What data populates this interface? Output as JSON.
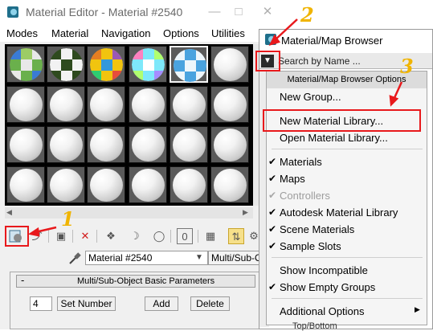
{
  "material_editor": {
    "title": "Material Editor - Material #2540",
    "menu": [
      "Modes",
      "Material",
      "Navigation",
      "Options",
      "Utilities"
    ],
    "material_name": "Material #2540",
    "material_type": "Multi/Sub-Obj",
    "rollout_title": "Multi/Sub-Object Basic Parameters",
    "rollout_collapse": "-",
    "sub_count": "4",
    "set_number_label": "Set Number",
    "add_label": "Add",
    "delete_label": "Delete"
  },
  "browser": {
    "title": "Material/Map Browser",
    "search_placeholder": "Search by Name ...",
    "menu_button_icon": "triangle-down-icon",
    "options_header": "Material/Map Browser Options",
    "items": {
      "new_group": "New Group...",
      "new_material_library": "New Material Library...",
      "open_material_library": "Open Material Library...",
      "materials": "Materials",
      "maps": "Maps",
      "controllers": "Controllers",
      "autodesk_material_library": "Autodesk Material Library",
      "scene_materials": "Scene Materials",
      "sample_slots": "Sample Slots",
      "show_incompatible": "Show Incompatible",
      "show_empty_groups": "Show Empty Groups",
      "additional_options": "Additional Options"
    },
    "background_item": "Top/Bottom"
  },
  "annotations": {
    "step1": "1",
    "step2": "2",
    "step3": "3",
    "color": "#e8191c",
    "number_color": "#f0b400"
  }
}
